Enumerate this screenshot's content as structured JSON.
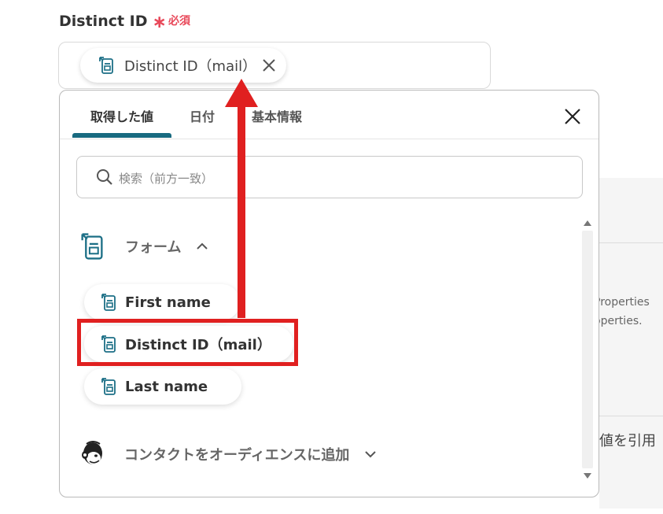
{
  "field": {
    "label": "Distinct ID",
    "required_mark": "∗",
    "required_text": "必須",
    "selected_chip": "Distinct ID（mail）"
  },
  "popup": {
    "tabs": [
      {
        "label": "取得した値"
      },
      {
        "label": "日付"
      },
      {
        "label": "基本情報"
      }
    ],
    "search_placeholder": "検索（前方一致）",
    "groups": [
      {
        "label": "フォーム",
        "items": [
          {
            "label": "First name"
          },
          {
            "label": "Distinct ID（mail）"
          },
          {
            "label": "Last name"
          }
        ]
      },
      {
        "label": "コンタクトをオーディエンスに追加"
      }
    ]
  },
  "background": {
    "text1": "Properties",
    "text2": "operties.",
    "text3": "値を引用"
  },
  "colors": {
    "accent": "#186a80",
    "required": "#e8495a",
    "annotation": "#e02020"
  }
}
